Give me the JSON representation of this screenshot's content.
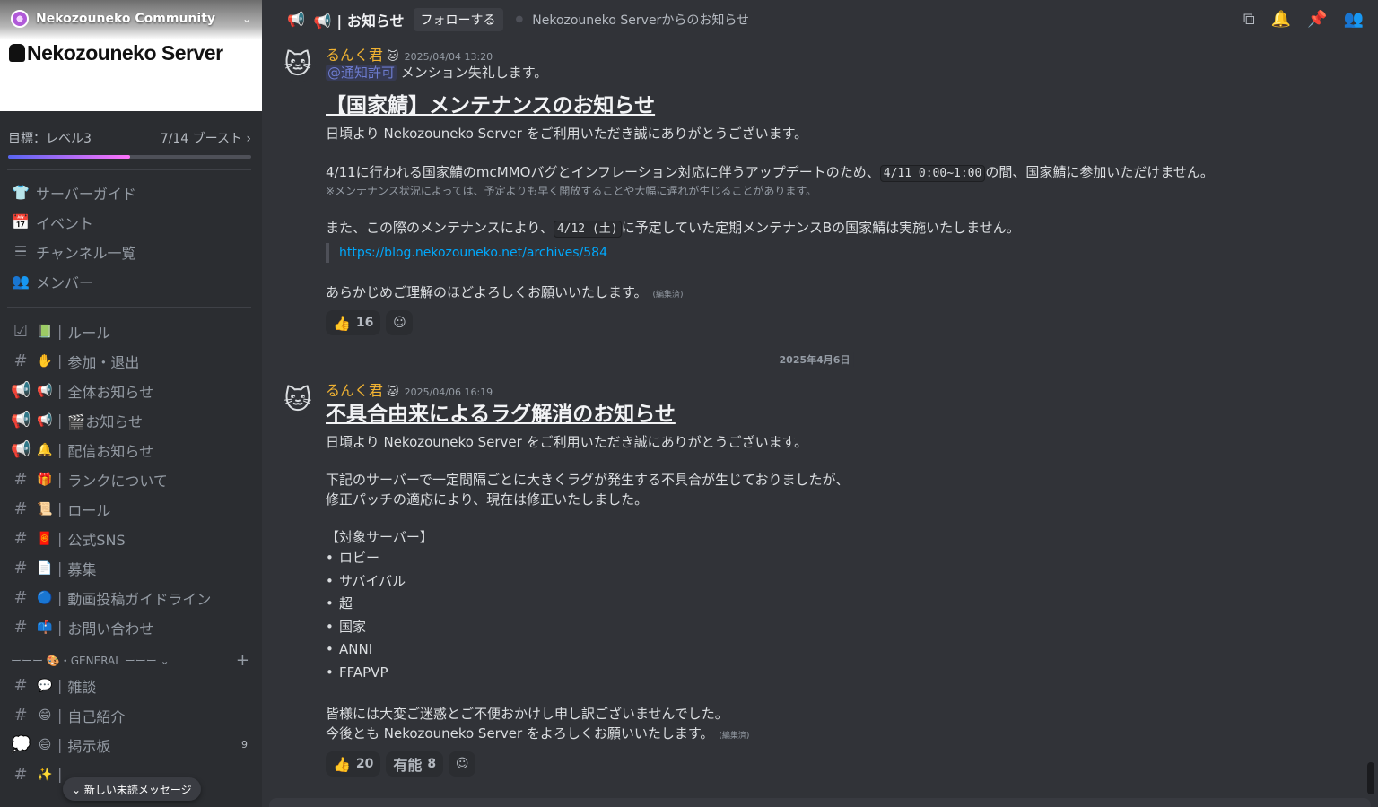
{
  "server": {
    "name": "Nekozouneko Community",
    "banner_text": "Nekozouneko Server",
    "boost_goal": "目標：レベル3",
    "boost_count": "7/14 ブースト ›",
    "boost_progress": 0.5
  },
  "nav": [
    {
      "icon": "👕",
      "label": "サーバーガイド"
    },
    {
      "icon": "📅",
      "label": "イベント"
    },
    {
      "icon": "☰",
      "label": "チャンネル一覧"
    },
    {
      "icon": "👥",
      "label": "メンバー"
    }
  ],
  "channels": [
    {
      "type": "☑",
      "emoji": "📗",
      "label": "ルール"
    },
    {
      "type": "#",
      "emoji": "✋",
      "label": "参加・退出"
    },
    {
      "type": "📢",
      "emoji": "📢",
      "label": "全体お知らせ"
    },
    {
      "type": "📢",
      "emoji": "📢",
      "label": "🎬お知らせ"
    },
    {
      "type": "📢",
      "emoji": "🔔",
      "label": "配信お知らせ"
    },
    {
      "type": "#",
      "emoji": "🎁",
      "label": "ランクについて"
    },
    {
      "type": "#",
      "emoji": "📜",
      "label": "ロール"
    },
    {
      "type": "#",
      "emoji": "🧧",
      "label": "公式SNS"
    },
    {
      "type": "#",
      "emoji": "📄",
      "label": "募集"
    },
    {
      "type": "#",
      "emoji": "🔵",
      "label": "動画投稿ガイドライン"
    },
    {
      "type": "#",
      "emoji": "📫",
      "label": "お問い合わせ"
    }
  ],
  "category": {
    "label": "ーーー 🎨・GENERAL ーーー ⌄",
    "plus": "+"
  },
  "general_channels": [
    {
      "type": "#",
      "emoji": "💬",
      "label": "雑談",
      "badge": ""
    },
    {
      "type": "#",
      "emoji": "😄",
      "label": "自己紹介",
      "badge": ""
    },
    {
      "type": "💭",
      "emoji": "😄",
      "label": "掲示板",
      "badge": "9"
    },
    {
      "type": "#",
      "emoji": "✨",
      "label": "",
      "badge": ""
    }
  ],
  "unread_pill": "⌄ 新しい未読メッセージ",
  "topbar": {
    "channel": "📢 | お知らせ",
    "follow": "フォローする",
    "topic": "Nekozouneko Serverからのお知らせ"
  },
  "message1": {
    "author": "るんく君",
    "timestamp": "2025/04/04 13:20",
    "mention": "@通知許可",
    "mention_after": " メンション失礼します。",
    "heading": "【国家鯖】メンテナンスのお知らせ",
    "p1": "日頃より Nekozouneko Server をご利用いただき誠にありがとうございます。",
    "p2_before": "4/11に行われる国家鯖のmcMMOバグとインフレーション対応に伴うアップデートのため、",
    "p2_code": "4/11 0:00~1:00",
    "p2_after": "の間、国家鯖に参加いただけません。",
    "p2_note": "※メンテナンス状況によっては、予定よりも早く開放することや大幅に遅れが生じることがあります。",
    "p3_before": "また、この際のメンテナンスにより、",
    "p3_code": "4/12 (土)",
    "p3_after": "に予定していた定期メンテナンスBの国家鯖は実施いたしません。",
    "link": "https://blog.nekozouneko.net/archives/584",
    "p4": "あらかじめご理解のほどよろしくお願いいたします。",
    "edited": "(編集済)",
    "reactions": [
      {
        "emoji": "👍",
        "count": "16"
      }
    ]
  },
  "date_separator": "2025年4月6日",
  "message2": {
    "author": "るんく君",
    "timestamp": "2025/04/06 16:19",
    "heading": "不具合由来によるラグ解消のお知らせ",
    "p1": "日頃より Nekozouneko Server をご利用いただき誠にありがとうございます。",
    "p2a": "下記のサーバーで一定間隔ごとに大きくラグが発生する不具合が生じておりましたが、",
    "p2b": "修正パッチの適応により、現在は修正いたしました。",
    "list_title": "【対象サーバー】",
    "servers": [
      "ロビー",
      "サバイバル",
      "超",
      "国家",
      "ANNI",
      "FFAPVP"
    ],
    "p3a": "皆様には大変ご迷惑とご不便おかけし申し訳ございませんでした。",
    "p3b": "今後とも Nekozouneko Server をよろしくお願いいたします。",
    "edited": "(編集済)",
    "reactions": [
      {
        "emoji": "👍",
        "count": "20"
      },
      {
        "emoji": "有能",
        "count": "8"
      }
    ]
  },
  "colors": {
    "accent": "#5865f2",
    "author": "#f0b232",
    "link": "#00a8fc"
  }
}
